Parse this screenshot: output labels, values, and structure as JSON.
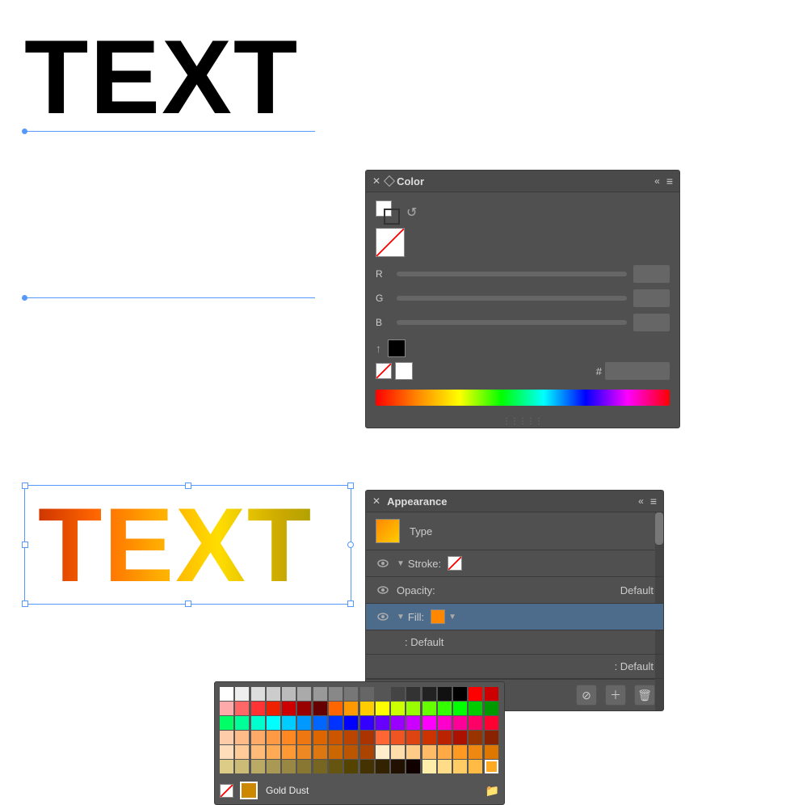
{
  "canvas": {
    "background": "#ffffff"
  },
  "top_text": {
    "label": "TEXT",
    "color": "#000000"
  },
  "gradient_text": {
    "label": "TEXT"
  },
  "color_panel": {
    "title": "Color",
    "close_btn": "✕",
    "collapse_btn": "«",
    "menu_btn": "≡",
    "r_label": "R",
    "g_label": "G",
    "b_label": "B",
    "hash_label": "#"
  },
  "appearance_panel": {
    "title": "Appearance",
    "close_btn": "✕",
    "collapse_btn": "«",
    "menu_btn": "≡",
    "type_label": "Type",
    "stroke_label": "Stroke:",
    "opacity_label": "Opacity:",
    "opacity_value": "Default",
    "fill_label": "Fill:",
    "default_label": ": Default",
    "no_label": ": Default"
  },
  "color_picker": {
    "gold_dust_label": "Gold Dust",
    "swatches": [
      "#ffffff",
      "#eeeeee",
      "#dddddd",
      "#cccccc",
      "#bbbbbb",
      "#aaaaaa",
      "#999999",
      "#888888",
      "#777777",
      "#666666",
      "#555555",
      "#444444",
      "#333333",
      "#222222",
      "#111111",
      "#000000",
      "#ff0000",
      "#cc0000",
      "#ffaaaa",
      "#ff6666",
      "#ff3333",
      "#ee2200",
      "#cc0000",
      "#990000",
      "#660000",
      "#ff6600",
      "#ff9900",
      "#ffcc00",
      "#ffff00",
      "#ccff00",
      "#99ff00",
      "#66ff00",
      "#33ff00",
      "#00ff00",
      "#00cc00",
      "#009900",
      "#00ff66",
      "#00ff99",
      "#00ffcc",
      "#00ffff",
      "#00ccff",
      "#0099ff",
      "#0066ff",
      "#0033ff",
      "#0000ff",
      "#3300ff",
      "#6600ff",
      "#9900ff",
      "#cc00ff",
      "#ff00ff",
      "#ff00cc",
      "#ff0099",
      "#ff0066",
      "#ff0033",
      "#ffccaa",
      "#ffbb88",
      "#ffaa66",
      "#ff9944",
      "#ff8822",
      "#ee7711",
      "#dd6600",
      "#cc5500",
      "#bb4400",
      "#aa3300",
      "#ff6633",
      "#ee5522",
      "#dd4411",
      "#cc3300",
      "#bb2200",
      "#aa1100",
      "#993300",
      "#882200",
      "#ffddbb",
      "#ffcc99",
      "#ffbb77",
      "#ffaa55",
      "#ff9933",
      "#ee8822",
      "#dd7711",
      "#cc6600",
      "#bb5500",
      "#aa4400",
      "#ffeecc",
      "#ffddaa",
      "#ffcc88",
      "#ffbb66",
      "#ffaa44",
      "#ff9922",
      "#ee8811",
      "#dd7700",
      "#ddcc88",
      "#ccbb77",
      "#bbaa66",
      "#aa9955",
      "#998844",
      "#887733",
      "#776622",
      "#665511",
      "#554400",
      "#443300",
      "#332200",
      "#221100",
      "#110000",
      "#ffeeaa",
      "#ffdd88",
      "#ffcc66",
      "#ffbb44",
      "#ffaa22"
    ]
  }
}
